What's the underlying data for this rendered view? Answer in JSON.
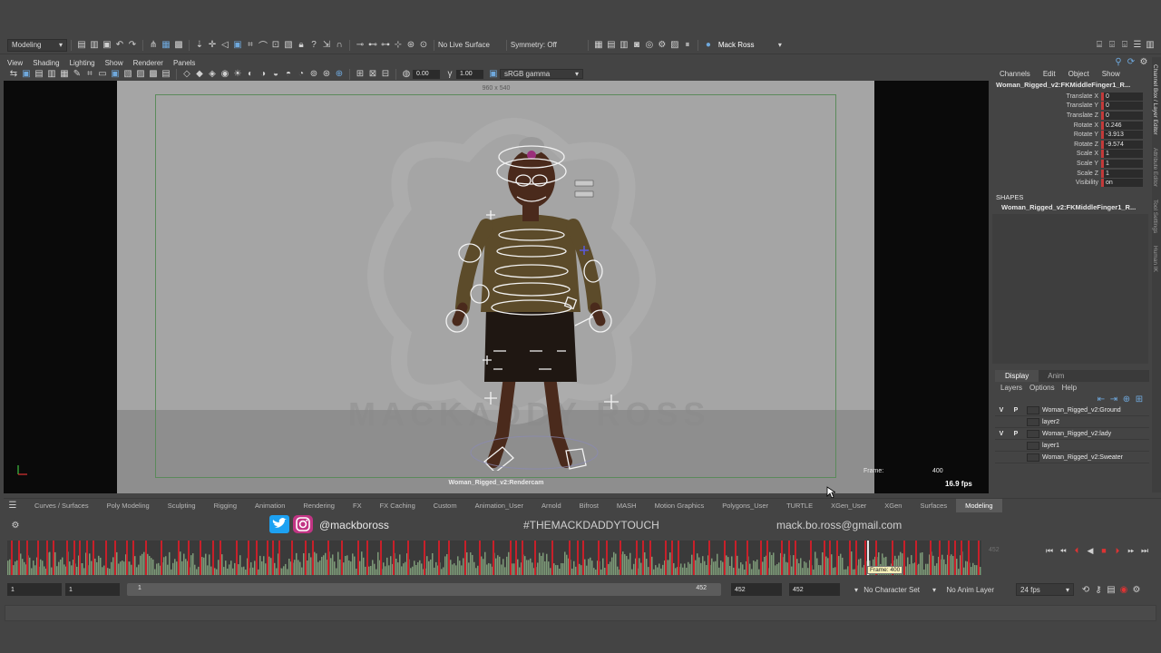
{
  "toolbar": {
    "mode_menu": "Modeling",
    "live_surface": "No Live Surface",
    "symmetry": "Symmetry: Off",
    "user": "Mack Ross"
  },
  "viewport": {
    "menu": [
      "View",
      "Shading",
      "Lighting",
      "Show",
      "Renderer",
      "Panels"
    ],
    "exposure": "0.00",
    "gamma": "1.00",
    "color_space": "sRGB gamma",
    "resolution": "960 x 540",
    "camera": "Woman_Rigged_v2:Rendercam",
    "frame_label": "Frame:",
    "frame_value": "400",
    "fps": "16.9 fps"
  },
  "channel_box": {
    "menu": [
      "Channels",
      "Edit",
      "Object",
      "Show"
    ],
    "object": "Woman_Rigged_v2:FKMiddleFinger1_R...",
    "attributes": [
      {
        "name": "Translate X",
        "value": "0"
      },
      {
        "name": "Translate Y",
        "value": "0"
      },
      {
        "name": "Translate Z",
        "value": "0"
      },
      {
        "name": "Rotate X",
        "value": "0.246"
      },
      {
        "name": "Rotate Y",
        "value": "-3.913"
      },
      {
        "name": "Rotate Z",
        "value": "-9.574"
      },
      {
        "name": "Scale X",
        "value": "1"
      },
      {
        "name": "Scale Y",
        "value": "1"
      },
      {
        "name": "Scale Z",
        "value": "1"
      },
      {
        "name": "Visibility",
        "value": "on"
      }
    ],
    "shapes_header": "SHAPES",
    "shape": "Woman_Rigged_v2:FKMiddleFinger1_R..."
  },
  "side_tabs": [
    "Channel Box / Layer Editor",
    "Attribute Editor",
    "Tool Settings",
    "Human IK"
  ],
  "layer_editor": {
    "tabs": [
      "Display",
      "Anim"
    ],
    "menu": [
      "Layers",
      "Options",
      "Help"
    ],
    "layers": [
      {
        "v": "V",
        "p": "P",
        "name": "Woman_Rigged_v2:Ground",
        "color": "#3d3d3d"
      },
      {
        "v": "",
        "p": "",
        "name": "layer2",
        "color": "#3d3d3d"
      },
      {
        "v": "V",
        "p": "P",
        "name": "Woman_Rigged_v2:lady",
        "color": "#3d3d3d"
      },
      {
        "v": "",
        "p": "",
        "name": "layer1",
        "color": "#3d3d3d"
      },
      {
        "v": "",
        "p": "",
        "name": "Woman_Rigged_v2:Sweater",
        "color": "#3d3d3d"
      }
    ]
  },
  "shelf_tabs": [
    "Curves / Surfaces",
    "Poly Modeling",
    "Sculpting",
    "Rigging",
    "Animation",
    "Rendering",
    "FX",
    "FX Caching",
    "Custom",
    "Animation_User",
    "Arnold",
    "Bifrost",
    "MASH",
    "Motion Graphics",
    "Polygons_User",
    "TURTLE",
    "XGen_User",
    "XGen",
    "Surfaces",
    "Modeling"
  ],
  "active_shelf": "Modeling",
  "overlay": {
    "handle": "@mackboross",
    "hashtag": "#THEMACKDADDYTOUCH",
    "email": "mack.bo.ross@gmail.com"
  },
  "timeline": {
    "end_label": "452",
    "tooltip": "Frame: 400"
  },
  "range": {
    "start": "1",
    "playback_start": "1",
    "slider_start": "1",
    "slider_end": "452",
    "playback_end": "452",
    "end": "452",
    "character_set": "No Character Set",
    "anim_layer": "No Anim Layer",
    "fps": "24 fps"
  }
}
